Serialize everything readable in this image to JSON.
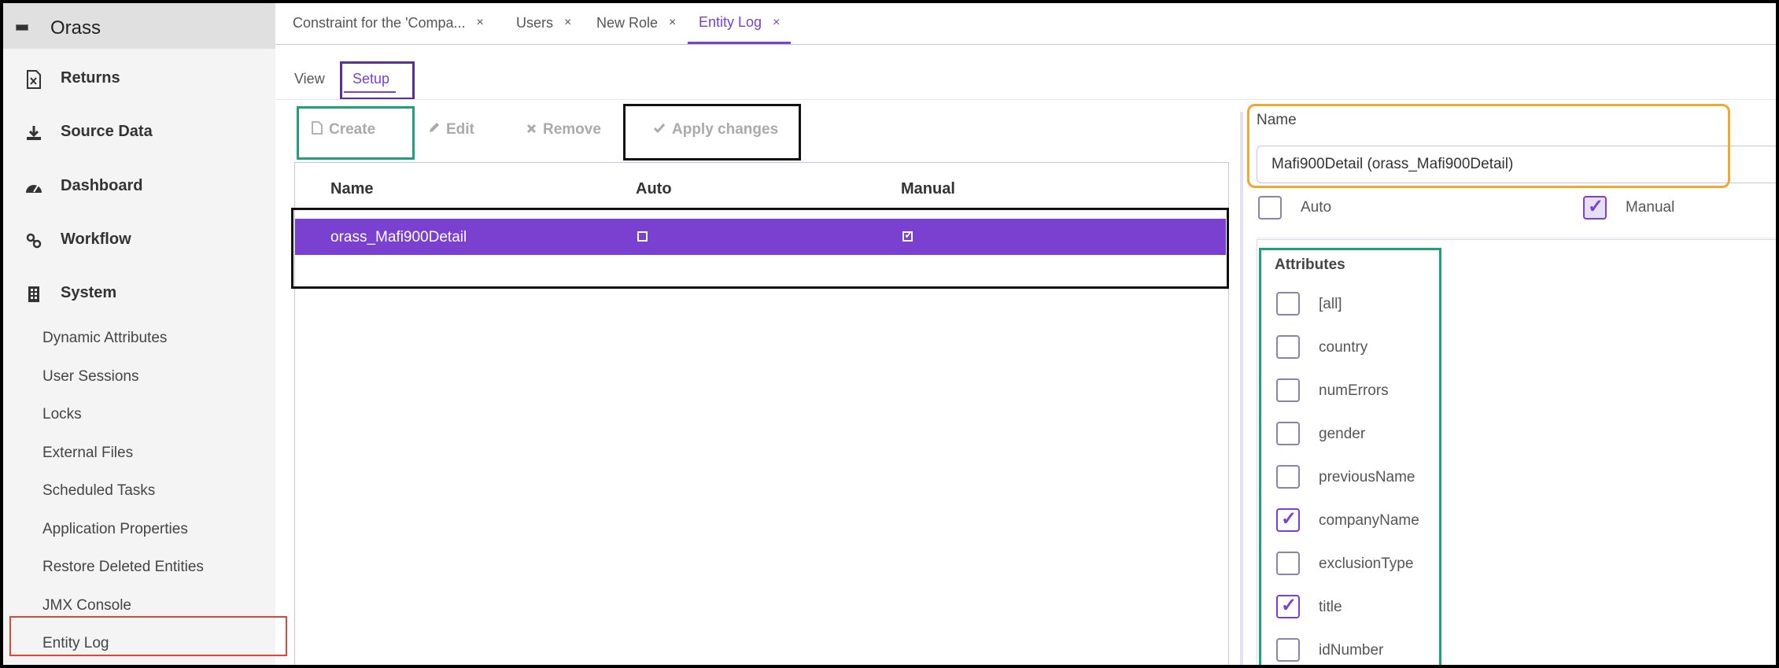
{
  "app": {
    "title": "Orass"
  },
  "sidebar": {
    "items": [
      {
        "label": "Returns",
        "icon": "excel-file-icon"
      },
      {
        "label": "Source Data",
        "icon": "download-icon"
      },
      {
        "label": "Dashboard",
        "icon": "dashboard-gauge-icon"
      },
      {
        "label": "Workflow",
        "icon": "workflow-link-icon"
      },
      {
        "label": "System",
        "icon": "building-icon"
      }
    ],
    "system_items": [
      "Dynamic Attributes",
      "User Sessions",
      "Locks",
      "External Files",
      "Scheduled Tasks",
      "Application Properties",
      "Restore Deleted Entities",
      "JMX Console",
      "Entity Log"
    ]
  },
  "tabs": [
    {
      "label": "Constraint for the 'Compa...",
      "close": "×",
      "active": false
    },
    {
      "label": "Users",
      "close": "×",
      "active": false
    },
    {
      "label": "New Role",
      "close": "×",
      "active": false
    },
    {
      "label": "Entity Log",
      "close": "×",
      "active": true
    }
  ],
  "subtabs": {
    "view": "View",
    "setup": "Setup"
  },
  "toolbar": {
    "create": "Create",
    "edit": "Edit",
    "remove": "Remove",
    "apply": "Apply changes"
  },
  "table": {
    "columns": [
      "Name",
      "Auto",
      "Manual"
    ],
    "rows": [
      {
        "name": "orass_Mafi900Detail",
        "auto": false,
        "manual": true
      }
    ]
  },
  "detail": {
    "name_label": "Name",
    "name_value": "Mafi900Detail (orass_Mafi900Detail)",
    "auto_label": "Auto",
    "auto_checked": false,
    "manual_label": "Manual",
    "manual_checked": true,
    "attributes_title": "Attributes",
    "attributes": [
      {
        "label": "[all]",
        "checked": false
      },
      {
        "label": "country",
        "checked": false
      },
      {
        "label": "numErrors",
        "checked": false
      },
      {
        "label": "gender",
        "checked": false
      },
      {
        "label": "previousName",
        "checked": false
      },
      {
        "label": "companyName",
        "checked": true
      },
      {
        "label": "exclusionType",
        "checked": false
      },
      {
        "label": "title",
        "checked": true
      },
      {
        "label": "idNumber",
        "checked": false
      }
    ]
  },
  "colors": {
    "accent": "#7a40d0",
    "highlight_red": "#e0453b",
    "highlight_green": "#1f9f7d",
    "highlight_orange": "#f0a830",
    "highlight_purple": "#5c2f96"
  }
}
